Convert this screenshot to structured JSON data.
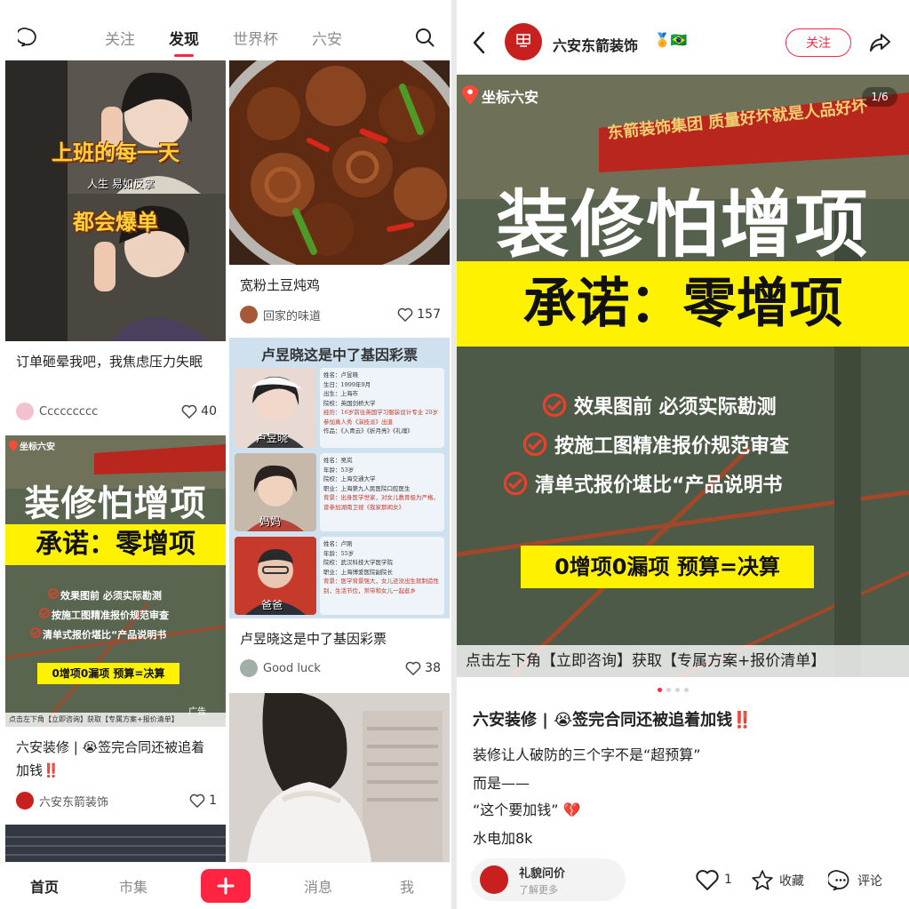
{
  "feed_app": {
    "tabs": [
      "关注",
      "发现",
      "世界杯",
      "六安"
    ],
    "active_tab": "发现",
    "cards": [
      {
        "image_text_1": "上班的每一天",
        "image_text_2": "人生 易如反掌",
        "image_text_3": "都会爆单",
        "title": "订单砸晕我吧，我焦虑压力失眠",
        "author": "Ccccccccc",
        "likes": "40"
      },
      {
        "title": "宽粉土豆炖鸡",
        "author": "回家的味道",
        "likes": "157"
      },
      {
        "image_title": "卢昱晓这是中了基因彩票",
        "profiles": [
          {
            "caption": "卢昱晓",
            "lines": [
              "姓名：卢昱晓",
              "生日：1999年9月",
              "出生：上海市",
              "院校：英国剑桥大学",
              "经历：16岁前往英国学习服装设计专业 20岁参加真人秀《演技派》出道",
              "作品：《入青云》《折月亮》《礼魂》"
            ]
          },
          {
            "caption": "妈妈",
            "lines": [
              "姓名：吴岚",
              "年龄：53岁",
              "院校：上海交通大学",
              "职业：上海第九人民医院口腔医生",
              "背景：出身医学世家，对女儿教育极为严格，曾参加湖南卫视《我家那闺女》"
            ]
          },
          {
            "caption": "爸爸",
            "lines": [
              "姓名：卢刚",
              "年龄：55岁",
              "院校：武汉科技大学医学院",
              "职业：上海博爱医院副院长",
              "背景：医学背景强大，女儿还没出生就制造性别，生活节俭，常带和女儿一起逛乡"
            ]
          }
        ],
        "title": "卢昱晓这是中了基因彩票",
        "author": "Good luck",
        "likes": "38"
      },
      {
        "image_location": "坐标六安",
        "image_headline": "装修怕增项",
        "image_promise": "承诺：零增项",
        "image_bullets": [
          "效果图前 必须实际勘测",
          "按施工图精准报价规范审查",
          "清单式报价堪比“产品说明书"
        ],
        "image_box": "0增项0漏项 预算=决算",
        "image_footer": "点击左下角【立即咨询】获取【专属方案+报价清单】",
        "ad_label": "广告",
        "title_prefix": "六安装修 | ",
        "emoji_1": "😭",
        "title_main": "签完合同还被追着加钱",
        "emoji_2": "‼️",
        "author": "六安东箭装饰",
        "likes": "1"
      }
    ],
    "bottom_nav": {
      "home": "首页",
      "market": "市集",
      "messages": "消息",
      "me": "我"
    }
  },
  "post": {
    "account_name": "六安东箭装饰",
    "badge_emoji": "🏅🇧🇷",
    "follow_label": "关注",
    "image_counter": "1/6",
    "location": "坐标六安",
    "banner_text": "东箭装饰集团 质量好坏就是人品好坏",
    "headline": "装修怕增项",
    "promise": "承诺：零增项",
    "bullets": [
      "效果图前 必须实际勘测",
      "按施工图精准报价规范审查",
      "清单式报价堪比“产品说明书"
    ],
    "box_text": "0增项0漏项 预算=决算",
    "footer_text": "点击左下角【立即咨询】获取【专属方案+报价清单】",
    "title_prefix": "六安装修 | ",
    "title_emoji_1": "😭",
    "title_main": "签完合同还被追着加钱",
    "title_emoji_2": "‼️",
    "body_lines": [
      "装修让人破防的三个字不是“超预算”",
      "而是——",
      "“这个要加钱”",
      "水电加8k"
    ],
    "body_emoji": "💔",
    "inquiry_label": "礼貌问价",
    "inquiry_sub": "了解更多",
    "likes": "1",
    "collect_label": "收藏",
    "comment_label": "评论",
    "colors": {
      "brand_red": "#ff2442",
      "highlight_yellow": "#fff200",
      "logo_red": "#c8201e"
    }
  }
}
